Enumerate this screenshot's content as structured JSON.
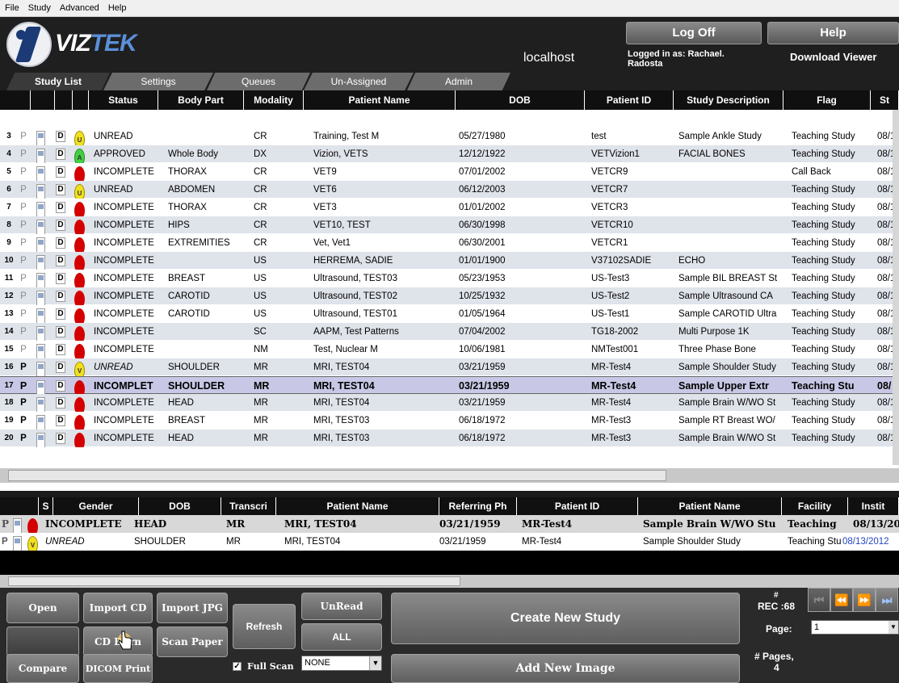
{
  "menu": [
    "File",
    "Study",
    "Advanced",
    "Help"
  ],
  "header": {
    "logo": "VIZTEK",
    "logo_a": "VIZ",
    "logo_b": "TEK",
    "server": "localhost",
    "logged_in": "Logged in as: Rachael. Radosta",
    "log_off": "Log Off",
    "help": "Help",
    "download_viewer": "Download Viewer"
  },
  "tabs": [
    "Study List",
    "Settings",
    "Queues",
    "Un-Assigned",
    "Admin"
  ],
  "grid": {
    "columns": [
      "Status",
      "Body Part",
      "Modality",
      "Patient Name",
      "DOB",
      "Patient ID",
      "Study Description",
      "Flag",
      "St"
    ],
    "rows": [
      {
        "num": "3",
        "p": "P",
        "d": "D",
        "icon": "U",
        "icon_color": "yellow",
        "status": "UNREAD",
        "body": "",
        "mod": "CR",
        "name": "Training, Test M",
        "dob": "05/27/1980",
        "pid": "test",
        "desc": "Sample Ankle Study",
        "flag": "Teaching Study",
        "st": "08/1"
      },
      {
        "num": "4",
        "p": "P",
        "d": "D",
        "icon": "A",
        "icon_color": "green",
        "status": "APPROVED",
        "body": "Whole Body",
        "mod": "DX",
        "name": "Vizion, VETS",
        "dob": "12/12/1922",
        "pid": "VETVizion1",
        "desc": "FACIAL BONES",
        "flag": "Teaching Study",
        "st": "08/1"
      },
      {
        "num": "5",
        "p": "P",
        "d": "D",
        "icon": "",
        "icon_color": "red",
        "status": "INCOMPLETE",
        "body": "THORAX",
        "mod": "CR",
        "name": "VET9",
        "dob": "07/01/2002",
        "pid": "VETCR9",
        "desc": "",
        "flag": "Call Back",
        "st": "08/1"
      },
      {
        "num": "6",
        "p": "P",
        "d": "D",
        "icon": "U",
        "icon_color": "yellow",
        "status": "UNREAD",
        "body": "ABDOMEN",
        "mod": "CR",
        "name": "VET6",
        "dob": "06/12/2003",
        "pid": "VETCR7",
        "desc": "",
        "flag": "Teaching Study",
        "st": "08/1"
      },
      {
        "num": "7",
        "p": "P",
        "d": "D",
        "icon": "",
        "icon_color": "red",
        "status": "INCOMPLETE",
        "body": "THORAX",
        "mod": "CR",
        "name": "VET3",
        "dob": "01/01/2002",
        "pid": "VETCR3",
        "desc": "",
        "flag": "Teaching Study",
        "st": "08/1"
      },
      {
        "num": "8",
        "p": "P",
        "d": "D",
        "icon": "",
        "icon_color": "red",
        "status": "INCOMPLETE",
        "body": "HIPS",
        "mod": "CR",
        "name": "VET10, TEST",
        "dob": "06/30/1998",
        "pid": "VETCR10",
        "desc": "",
        "flag": "Teaching Study",
        "st": "08/1"
      },
      {
        "num": "9",
        "p": "P",
        "d": "D",
        "icon": "",
        "icon_color": "red",
        "status": "INCOMPLETE",
        "body": "EXTREMITIES",
        "mod": "CR",
        "name": "Vet, Vet1",
        "dob": "06/30/2001",
        "pid": "VETCR1",
        "desc": "",
        "flag": "Teaching Study",
        "st": "08/1"
      },
      {
        "num": "10",
        "p": "P",
        "d": "D",
        "icon": "",
        "icon_color": "red",
        "status": "INCOMPLETE",
        "body": "",
        "mod": "US",
        "name": "HERREMA, SADIE",
        "dob": "01/01/1900",
        "pid": "V37102SADIE",
        "desc": "ECHO",
        "flag": "Teaching Study",
        "st": "08/1"
      },
      {
        "num": "11",
        "p": "P",
        "d": "D",
        "icon": "",
        "icon_color": "red",
        "status": "INCOMPLETE",
        "body": "BREAST",
        "mod": "US",
        "name": "Ultrasound, TEST03",
        "dob": "05/23/1953",
        "pid": "US-Test3",
        "desc": "Sample BIL BREAST St",
        "flag": "Teaching Study",
        "st": "08/1"
      },
      {
        "num": "12",
        "p": "P",
        "d": "D",
        "icon": "",
        "icon_color": "red",
        "status": "INCOMPLETE",
        "body": "CAROTID",
        "mod": "US",
        "name": "Ultrasound, TEST02",
        "dob": "10/25/1932",
        "pid": "US-Test2",
        "desc": "Sample Ultrasound CA",
        "flag": "Teaching Study",
        "st": "08/1"
      },
      {
        "num": "13",
        "p": "P",
        "d": "D",
        "icon": "",
        "icon_color": "red",
        "status": "INCOMPLETE",
        "body": "CAROTID",
        "mod": "US",
        "name": "Ultrasound, TEST01",
        "dob": "01/05/1964",
        "pid": "US-Test1",
        "desc": "Sample CAROTID Ultra",
        "flag": "Teaching Study",
        "st": "08/1"
      },
      {
        "num": "14",
        "p": "P",
        "d": "D",
        "icon": "",
        "icon_color": "red",
        "status": "INCOMPLETE",
        "body": "",
        "mod": "SC",
        "name": "AAPM, Test Patterns",
        "dob": "07/04/2002",
        "pid": "TG18-2002",
        "desc": "Multi Purpose 1K",
        "flag": "Teaching Study",
        "st": "08/1"
      },
      {
        "num": "15",
        "p": "P",
        "d": "D",
        "icon": "",
        "icon_color": "red",
        "status": "INCOMPLETE",
        "body": "",
        "mod": "NM",
        "name": "Test, Nuclear M",
        "dob": "10/06/1981",
        "pid": "NMTest001",
        "desc": "Three Phase Bone",
        "flag": "Teaching Study",
        "st": "08/1"
      },
      {
        "num": "16",
        "p": "P",
        "d": "D",
        "icon": "V",
        "icon_color": "yellow",
        "status": "UNREAD",
        "body": "SHOULDER",
        "mod": "MR",
        "name": "MRI, TEST04",
        "dob": "03/21/1959",
        "pid": "MR-Test4",
        "desc": "Sample Shoulder Study",
        "flag": "Teaching Study",
        "st": "08/1"
      },
      {
        "num": "17",
        "p": "P",
        "d": "D",
        "icon": "",
        "icon_color": "red",
        "status": "INCOMPLET",
        "body": "SHOULDER",
        "mod": "MR",
        "name": "MRI, TEST04",
        "dob": "03/21/1959",
        "pid": "MR-Test4",
        "desc": "Sample Upper Extr",
        "flag": "Teaching Stu",
        "st": "08/"
      },
      {
        "num": "18",
        "p": "P",
        "d": "D",
        "icon": "",
        "icon_color": "red",
        "status": "INCOMPLETE",
        "body": "HEAD",
        "mod": "MR",
        "name": "MRI, TEST04",
        "dob": "03/21/1959",
        "pid": "MR-Test4",
        "desc": "Sample Brain W/WO St",
        "flag": "Teaching Study",
        "st": "08/1"
      },
      {
        "num": "19",
        "p": "P",
        "d": "D",
        "icon": "",
        "icon_color": "red",
        "status": "INCOMPLETE",
        "body": "BREAST",
        "mod": "MR",
        "name": "MRI, TEST03",
        "dob": "06/18/1972",
        "pid": "MR-Test3",
        "desc": "Sample RT Breast WO/",
        "flag": "Teaching Study",
        "st": "08/1"
      },
      {
        "num": "20",
        "p": "P",
        "d": "D",
        "icon": "",
        "icon_color": "red",
        "status": "INCOMPLETE",
        "body": "HEAD",
        "mod": "MR",
        "name": "MRI, TEST03",
        "dob": "06/18/1972",
        "pid": "MR-Test3",
        "desc": "Sample Brain W/WO St",
        "flag": "Teaching Study",
        "st": "08/1"
      }
    ]
  },
  "sub": {
    "columns": [
      "S",
      "Gender",
      "DOB",
      "Transcri",
      "Patient Name",
      "Referring Ph",
      "Patient ID",
      "Patient Name",
      "Facility",
      "Instit"
    ],
    "rows": [
      {
        "p": "P",
        "status": "INCOMPLETE",
        "body": "HEAD",
        "mod": "MR",
        "name": "MRI, TEST04",
        "dob": "03/21/1959",
        "pid": "MR-Test4",
        "desc": "Sample Brain W/WO Stu",
        "flag": "Teaching",
        "date": "08/13/20"
      },
      {
        "p": "P",
        "status": "UNREAD",
        "body": "SHOULDER",
        "mod": "MR",
        "name": "MRI, TEST04",
        "dob": "03/21/1959",
        "pid": "MR-Test4",
        "desc": "Sample Shoulder Study",
        "flag": "Teaching Stu",
        "date": "08/13/2012"
      }
    ]
  },
  "bottom": {
    "open": "Open",
    "import_cd": "Import CD",
    "import_jpg": "Import JPG",
    "refresh": "Refresh",
    "unread": "UnRead",
    "cd_burn": "CD Burn",
    "scan_paper": "Scan Paper",
    "all": "ALL",
    "compare": "Compare",
    "dicom_print": "DICOM Print",
    "create_new_study": "Create New Study",
    "add_new_image": "Add New Image",
    "full_scan": "Full Scan",
    "none_option": "NONE",
    "rec_label": "#",
    "rec": "REC :68",
    "page_label": "Page:",
    "page_value": "1",
    "pages_label": "# Pages,",
    "pages": "4"
  }
}
